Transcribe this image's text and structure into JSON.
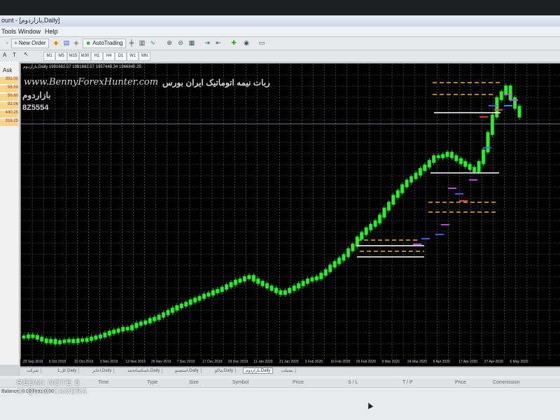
{
  "window": {
    "title": "ount - [بازاردوم,Daily]"
  },
  "menu": {
    "items": [
      "Tools",
      "Window",
      "Help"
    ]
  },
  "toolbar": {
    "new_order": "New Order",
    "auto_trading": "AutoTrading"
  },
  "timeframes": [
    "M1",
    "M5",
    "M15",
    "M30",
    "H1",
    "H4",
    "D1",
    "W1",
    "MN"
  ],
  "sidebar": {
    "ask_label": "Ask",
    "rows": [
      "391.00",
      "56.59",
      "56.80",
      "92.06",
      "440.25",
      "316.25"
    ]
  },
  "chart": {
    "header": "بازاردوم,Daily 1991682.57 1991682.57 1957448.34 1966840.25",
    "watermark": "www.BennyForexHunter.com",
    "title_fa": "ربات نیمه اتوماتیک ایران بورس",
    "brand_fa": "بازاردوم",
    "code": "8Z5554"
  },
  "chart_data": {
    "type": "line",
    "x_tick_labels": [
      "29 Sep 2019",
      "9 Oct 2019",
      "22 Oct 2019",
      "3 Nov 2019",
      "13 Nov 2019",
      "25 Nov 2019",
      "7 Dec 2019",
      "17 Dec 2019",
      "29 Dec 2019",
      "11 Jan 2020",
      "21 Jan 2020",
      "3 Feb 2020",
      "16 Feb 2020",
      "26 Feb 2020",
      "9 Mar 2020",
      "24 Mar 2020",
      "6 Apr 2020",
      "17 Apr 2020",
      "27 Apr 2020",
      "6 May 2020"
    ],
    "series": [
      {
        "values": [
          470,
          468,
          469,
          472,
          475,
          478,
          476,
          480,
          478,
          477,
          476,
          478,
          475,
          476,
          474,
          472,
          470,
          468,
          465,
          462,
          460,
          458,
          455,
          456,
          452,
          448,
          446,
          444,
          440,
          438,
          434,
          430,
          426,
          422,
          418,
          415,
          412,
          408,
          405,
          402,
          398,
          396,
          392,
          390,
          386,
          382,
          378,
          374,
          372,
          368,
          366,
          372,
          376,
          380,
          384,
          388,
          392,
          395,
          392,
          388,
          384,
          380,
          376,
          372,
          370,
          368,
          362,
          356,
          348,
          342,
          336,
          330,
          320,
          312,
          300,
          292,
          284,
          278,
          272,
          262,
          250,
          240,
          228,
          220,
          210,
          202,
          196,
          190,
          182,
          176,
          168,
          160,
          160,
          158,
          154,
          160,
          165,
          170,
          175,
          180,
          184,
          170,
          150,
          120,
          90,
          60,
          50,
          40,
          60,
          75,
          90
        ]
      }
    ],
    "ylim": [
      0,
      520
    ],
    "grid": true
  },
  "bottom_tabs": [
    "شرکت",
    "1,کل,Daily",
    "اخابر,Daily",
    "نامنکساتحمد,Daily",
    "استصنو,Daily",
    "ماکو,Daily",
    "بازاردوم,Daily",
    "بصیلت"
  ],
  "terminal": {
    "columns": [
      "Time",
      "Type",
      "Size",
      "Symbol",
      "Price",
      "S / L",
      "T / P",
      "Price",
      "Commission"
    ],
    "balance": "Balance: 0.00 Free 0.00"
  },
  "overlay": {
    "line1": "REDMI NOTE 8",
    "line2": "AI QUAD CAMERA"
  }
}
